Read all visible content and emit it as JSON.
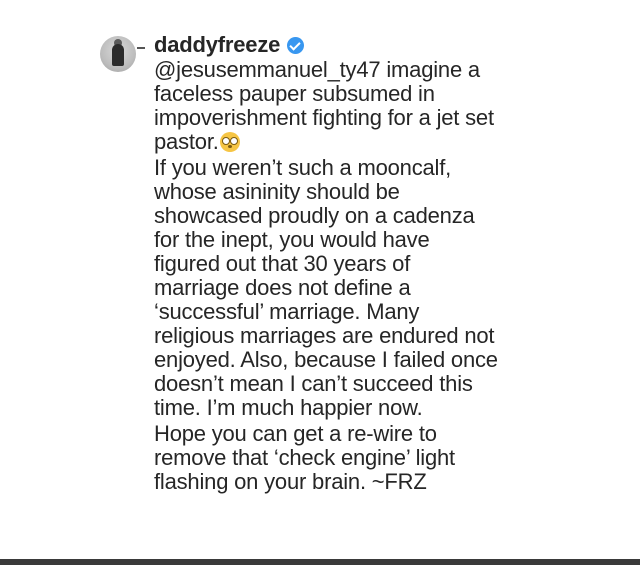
{
  "comment": {
    "username": "daddyfreeze",
    "verified_icon": "verified-badge-icon",
    "verified_color": "#3897f0",
    "paragraphs": [
      {
        "lines": [
          "@jesusemmanuel_ty47 imagine a",
          "faceless pauper subsumed in",
          "impoverishment fighting for a jet set",
          "pastor."
        ],
        "emoji": "flushed-face-emoji"
      },
      {
        "lines": [
          "If you weren’t such a mooncalf,",
          "whose asininity should be",
          "showcased proudly on a cadenza",
          "for the inept, you would have",
          "figured out that 30 years of",
          "marriage does not define a",
          "‘successful’ marriage. Many",
          "religious marriages are endured not",
          "enjoyed. Also, because I failed once",
          "doesn’t mean I can’t succeed this",
          "time. I’m much happier now."
        ]
      },
      {
        "lines": [
          "Hope you can get a re-wire to",
          "remove that ‘check engine’ light",
          "flashing on your brain. ~FRZ"
        ]
      }
    ]
  }
}
